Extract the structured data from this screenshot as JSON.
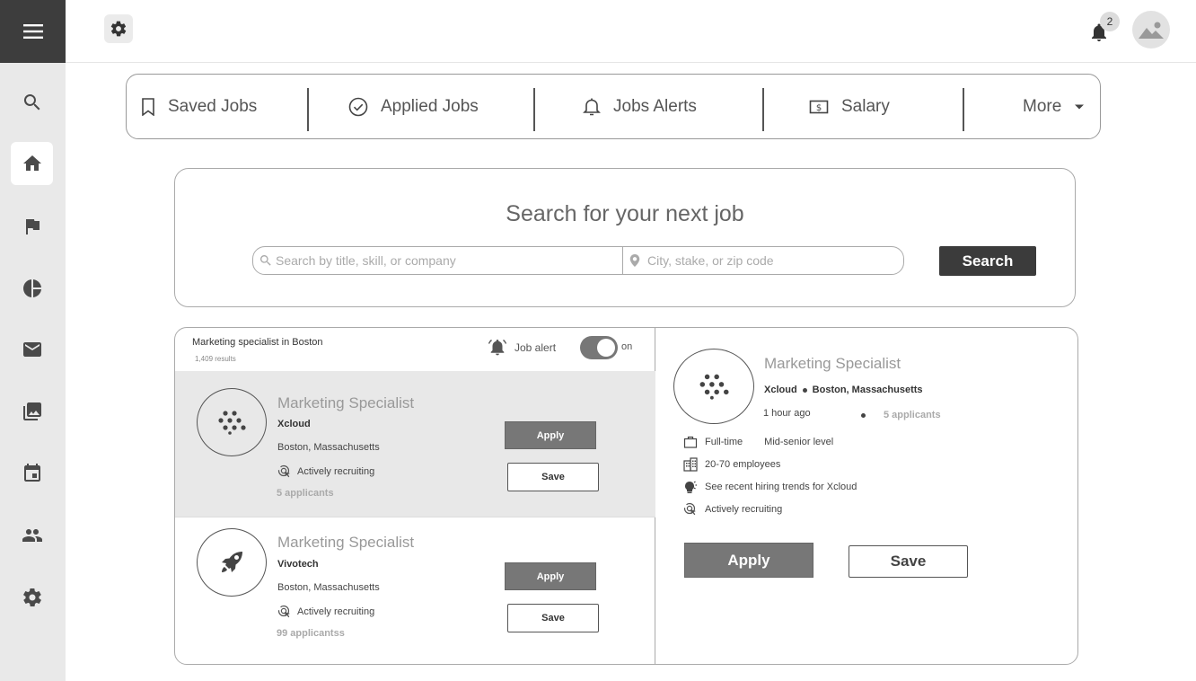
{
  "sidebar": {
    "menu_icon": "hamburger-menu-icon",
    "items": [
      {
        "icon": "search-icon"
      },
      {
        "icon": "home-icon",
        "active": true
      },
      {
        "icon": "flag-icon"
      },
      {
        "icon": "pie-chart-icon"
      },
      {
        "icon": "mail-icon"
      },
      {
        "icon": "photos-icon"
      },
      {
        "icon": "calendar-icon"
      },
      {
        "icon": "people-icon"
      },
      {
        "icon": "settings-icon"
      }
    ]
  },
  "topbar": {
    "notification_count": "2"
  },
  "nav": {
    "items": [
      {
        "label": "Saved Jobs",
        "icon": "bookmark-icon"
      },
      {
        "label": "Applied Jobs",
        "icon": "check-circle-icon"
      },
      {
        "label": "Jobs Alerts",
        "icon": "bell-icon"
      },
      {
        "label": "Salary",
        "icon": "money-icon"
      },
      {
        "label": "More",
        "icon": "caret-down-icon"
      }
    ]
  },
  "search": {
    "title": "Search for your next job",
    "keyword_placeholder": "Search by title, skill, or company",
    "location_placeholder": "City, stake, or zip code",
    "button_label": "Search"
  },
  "results": {
    "query_title": "Marketing specialist in Boston",
    "count": "1,409 results",
    "alert_label": "Job alert",
    "alert_state": "on",
    "jobs": [
      {
        "title": "Marketing Specialist",
        "company": "Xcloud",
        "location": "Boston, Massachusetts",
        "status": "Actively recruiting",
        "applicants": "5 applicants",
        "apply_label": "Apply",
        "save_label": "Save"
      },
      {
        "title": "Marketing Specialist",
        "company": "Vivotech",
        "location": "Boston, Massachusetts",
        "status": "Actively recruiting",
        "applicants": "99 applicantss",
        "apply_label": "Apply",
        "save_label": "Save"
      }
    ]
  },
  "detail": {
    "title": "Marketing Specialist",
    "company": "Xcloud",
    "location": "Boston, Massachusetts",
    "posted": "1 hour ago",
    "applicants": "5 applicants",
    "employment_type": "Full-time",
    "level": "Mid-senior level",
    "employees": "20-70 employees",
    "hiring_trends": "See recent hiring trends for Xcloud",
    "status": "Actively recruiting",
    "apply_label": "Apply",
    "save_label": "Save"
  }
}
